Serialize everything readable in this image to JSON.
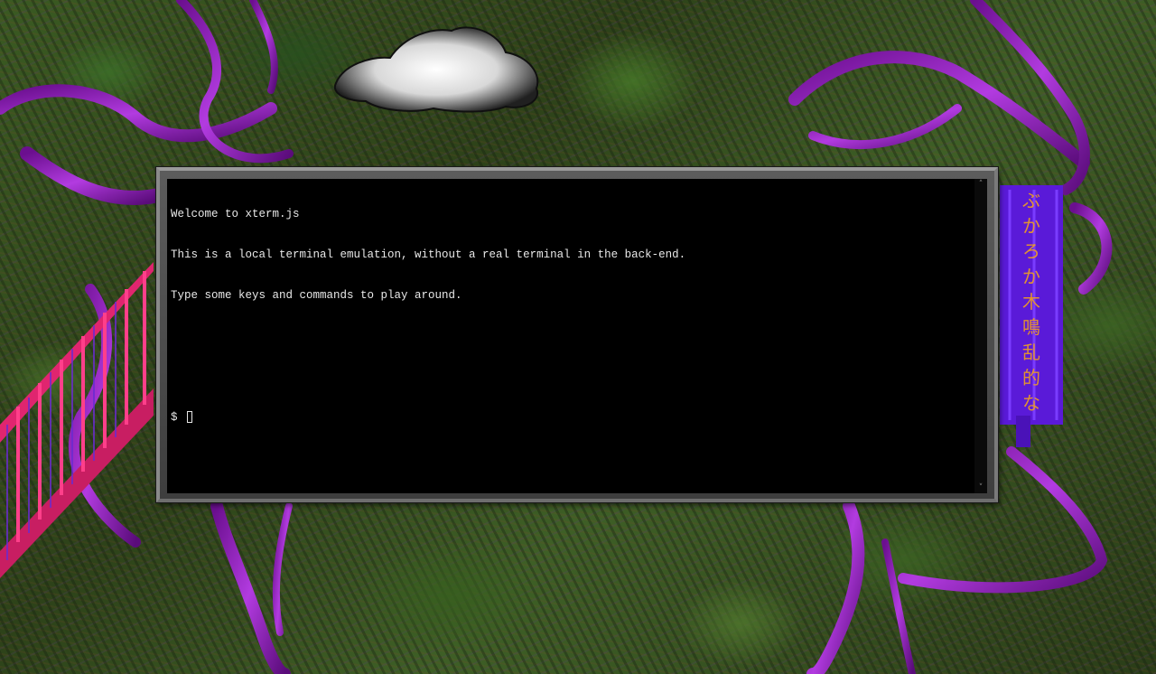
{
  "terminal": {
    "lines": [
      "Welcome to xterm.js",
      "This is a local terminal emulation, without a real terminal in the back-end.",
      "Type some keys and commands to play around.",
      ""
    ],
    "prompt": "$ "
  },
  "scrollbar": {
    "up_icon": "chevron-up-icon",
    "down_icon": "chevron-down-icon",
    "up_glyph": "˄",
    "down_glyph": "˅"
  },
  "colors": {
    "terminal_background": "#000000",
    "terminal_foreground": "#e8e8e8",
    "ribbon": "#9b1fc1",
    "stairs": "#e0256f",
    "sign_text": "#f0a020",
    "sign_background": "#5a1ad8"
  },
  "sign_glyphs": [
    "ぶ",
    "か",
    "ろ",
    "か",
    "木",
    "鳴",
    "乱",
    "的",
    "な"
  ]
}
